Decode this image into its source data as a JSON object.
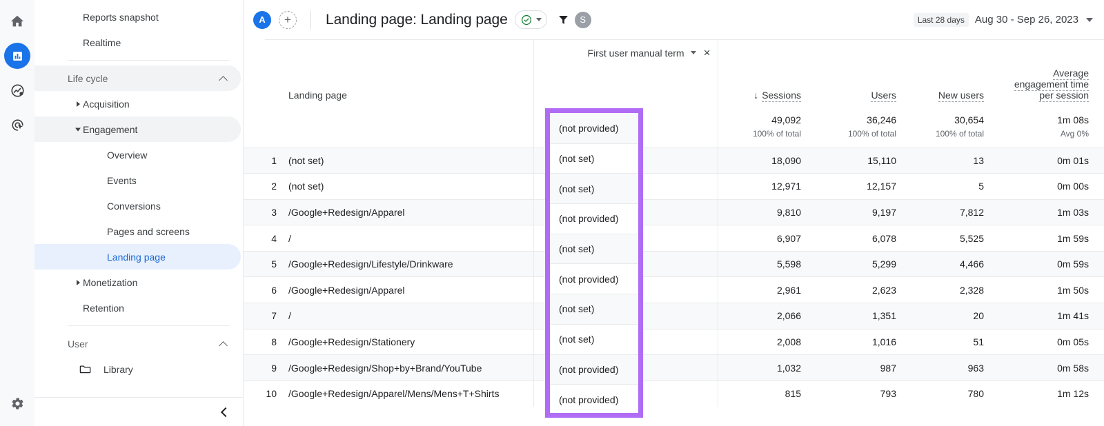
{
  "rail": {
    "items": [
      {
        "name": "home-icon",
        "label": "Home",
        "active": false
      },
      {
        "name": "reports-icon",
        "label": "Reports",
        "active": true
      },
      {
        "name": "explore-icon",
        "label": "Explore",
        "active": false
      },
      {
        "name": "advertising-icon",
        "label": "Advertising",
        "active": false
      }
    ],
    "settings": {
      "name": "settings-gear-icon",
      "label": "Admin"
    }
  },
  "sidebar": {
    "items": [
      {
        "label": "Reports snapshot",
        "level": 0,
        "type": "item",
        "state": "normal"
      },
      {
        "label": "Realtime",
        "level": 0,
        "type": "item",
        "state": "normal"
      },
      {
        "label": "Life cycle",
        "type": "section",
        "expanded": true,
        "state": "shaded"
      },
      {
        "label": "Acquisition",
        "level": 0,
        "type": "item",
        "state": "normal",
        "toggle": "collapsed"
      },
      {
        "label": "Engagement",
        "level": 0,
        "type": "item",
        "state": "shaded",
        "toggle": "expanded"
      },
      {
        "label": "Overview",
        "level": 1,
        "type": "item",
        "state": "normal"
      },
      {
        "label": "Events",
        "level": 1,
        "type": "item",
        "state": "normal"
      },
      {
        "label": "Conversions",
        "level": 1,
        "type": "item",
        "state": "normal"
      },
      {
        "label": "Pages and screens",
        "level": 1,
        "type": "item",
        "state": "normal"
      },
      {
        "label": "Landing page",
        "level": 1,
        "type": "item",
        "state": "selected"
      },
      {
        "label": "Monetization",
        "level": 0,
        "type": "item",
        "state": "normal",
        "toggle": "collapsed"
      },
      {
        "label": "Retention",
        "level": 0,
        "type": "item",
        "state": "normal"
      },
      {
        "label": "User",
        "type": "section",
        "expanded": true,
        "state": "normal"
      },
      {
        "label": "Library",
        "type": "folder",
        "icon": "folder-icon"
      }
    ],
    "collapse_icon": "chevron-left-icon"
  },
  "header": {
    "account_avatar": "A",
    "add_button": "+",
    "title": "Landing page: Landing page",
    "badge_icon": "check-circle-icon",
    "badge_caret": "chevron-down-icon",
    "filter_icon": "filter-funnel-icon",
    "user_avatar": "S",
    "date_tag": "Last 28 days",
    "date_range": "Aug 30 - Sep 26, 2023",
    "date_caret": "chevron-down-icon"
  },
  "table": {
    "dimension_header": "Landing page",
    "secondary_dimension": "First user manual term",
    "secondary_dimension_caret": "chevron-down-icon",
    "secondary_dimension_remove": "×",
    "metric_headers": [
      {
        "label": "Sessions",
        "sorted": true,
        "sort_icon": "arrow-down-icon"
      },
      {
        "label": "Users",
        "sorted": false
      },
      {
        "label": "New users",
        "sorted": false
      },
      {
        "label": "Average engagement time per session",
        "sorted": false
      }
    ],
    "totals": {
      "sessions": "49,092",
      "sessions_sub": "100% of total",
      "users": "36,246",
      "users_sub": "100% of total",
      "new_users": "30,654",
      "new_users_sub": "100% of total",
      "avg_engagement": "1m 08s",
      "avg_engagement_sub": "Avg 0%"
    },
    "rows": [
      {
        "index": "1",
        "landing_page": "(not set)",
        "sessions": "18,090",
        "users": "15,110",
        "new_users": "13",
        "avg_engagement": "0m 01s"
      },
      {
        "index": "2",
        "landing_page": "(not set)",
        "sessions": "12,971",
        "users": "12,157",
        "new_users": "5",
        "avg_engagement": "0m 00s"
      },
      {
        "index": "3",
        "landing_page": "/Google+Redesign/Apparel",
        "sessions": "9,810",
        "users": "9,197",
        "new_users": "7,812",
        "avg_engagement": "1m 03s"
      },
      {
        "index": "4",
        "landing_page": "/",
        "sessions": "6,907",
        "users": "6,078",
        "new_users": "5,525",
        "avg_engagement": "1m 59s"
      },
      {
        "index": "5",
        "landing_page": "/Google+Redesign/Lifestyle/Drinkware",
        "sessions": "5,598",
        "users": "5,299",
        "new_users": "4,466",
        "avg_engagement": "0m 59s"
      },
      {
        "index": "6",
        "landing_page": "/Google+Redesign/Apparel",
        "sessions": "2,961",
        "users": "2,623",
        "new_users": "2,328",
        "avg_engagement": "1m 50s"
      },
      {
        "index": "7",
        "landing_page": "/",
        "sessions": "2,066",
        "users": "1,351",
        "new_users": "20",
        "avg_engagement": "1m 41s"
      },
      {
        "index": "8",
        "landing_page": "/Google+Redesign/Stationery",
        "sessions": "2,008",
        "users": "1,016",
        "new_users": "51",
        "avg_engagement": "0m 05s"
      },
      {
        "index": "9",
        "landing_page": "/Google+Redesign/Shop+by+Brand/YouTube",
        "sessions": "1,032",
        "users": "987",
        "new_users": "963",
        "avg_engagement": "0m 58s"
      },
      {
        "index": "10",
        "landing_page": "/Google+Redesign/Apparel/Mens/Mens+T+Shirts",
        "sessions": "815",
        "users": "793",
        "new_users": "780",
        "avg_engagement": "1m 12s"
      }
    ]
  },
  "highlight": {
    "color": "#b06cf5",
    "values": [
      "(not provided)",
      "(not set)",
      "(not set)",
      "(not provided)",
      "(not set)",
      "(not provided)",
      "(not set)",
      "(not set)",
      "(not provided)",
      "(not provided)"
    ]
  }
}
